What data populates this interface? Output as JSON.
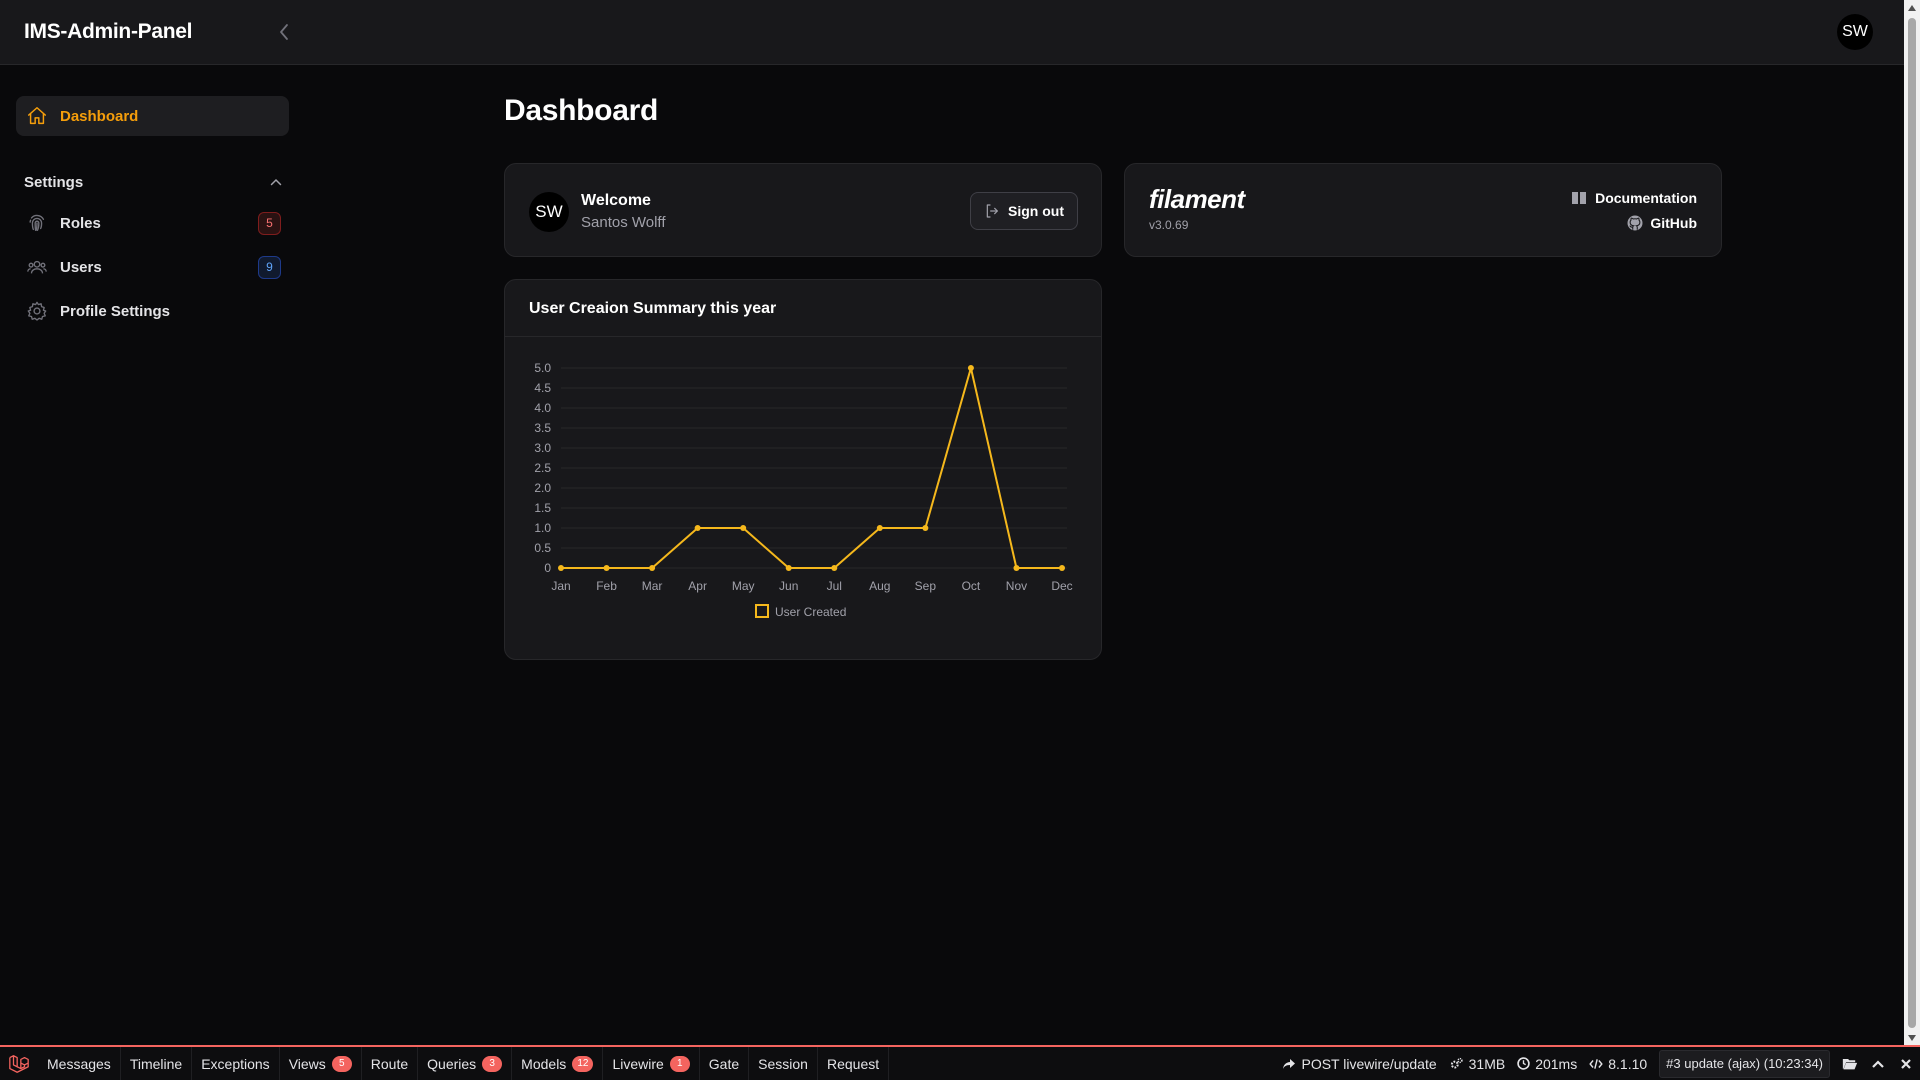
{
  "app": {
    "brand": "IMS-Admin-Panel",
    "user_initials": "SW"
  },
  "sidebar": {
    "active_item": {
      "label": "Dashboard",
      "icon": "home-icon"
    },
    "group": {
      "label": "Settings",
      "expanded": true
    },
    "items": [
      {
        "label": "Roles",
        "icon": "fingerprint-icon",
        "badge": "5",
        "badge_color": "#f87171"
      },
      {
        "label": "Users",
        "icon": "users-icon",
        "badge": "9",
        "badge_color": "#60a5fa"
      },
      {
        "label": "Profile Settings",
        "icon": "gear-icon"
      }
    ]
  },
  "page": {
    "title": "Dashboard"
  },
  "welcome": {
    "avatar": "SW",
    "title": "Welcome",
    "name": "Santos Wolff",
    "signout_label": "Sign out"
  },
  "filament": {
    "logo": "filament",
    "version": "v3.0.69",
    "docs_label": "Documentation",
    "github_label": "GitHub"
  },
  "chart": {
    "title": "User Creaion Summary this year"
  },
  "chart_data": {
    "type": "line",
    "categories": [
      "Jan",
      "Feb",
      "Mar",
      "Apr",
      "May",
      "Jun",
      "Jul",
      "Aug",
      "Sep",
      "Oct",
      "Nov",
      "Dec"
    ],
    "series": [
      {
        "name": "User Created",
        "values": [
          0,
          0,
          0,
          1,
          1,
          0,
          0,
          1,
          1,
          5,
          0,
          0
        ],
        "color": "#f5b81c"
      }
    ],
    "yticks": [
      "0",
      "0.5",
      "1.0",
      "1.5",
      "2.0",
      "2.5",
      "3.0",
      "3.5",
      "4.0",
      "4.5",
      "5.0"
    ],
    "ylim": [
      0,
      5
    ],
    "grid": true,
    "legend": "bottom"
  },
  "debugbar": {
    "tabs": [
      {
        "label": "Messages"
      },
      {
        "label": "Timeline"
      },
      {
        "label": "Exceptions"
      },
      {
        "label": "Views",
        "count": "5"
      },
      {
        "label": "Route"
      },
      {
        "label": "Queries",
        "count": "3"
      },
      {
        "label": "Models",
        "count": "12"
      },
      {
        "label": "Livewire",
        "count": "1"
      },
      {
        "label": "Gate"
      },
      {
        "label": "Session"
      },
      {
        "label": "Request"
      }
    ],
    "request": "POST livewire/update",
    "memory": "31MB",
    "time": "201ms",
    "php_version": "8.1.10",
    "selected_request": "#3 update (ajax) (10:23:34)",
    "accent": "#f4645f"
  }
}
